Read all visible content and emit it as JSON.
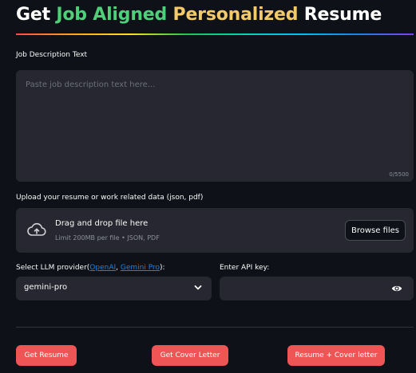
{
  "header": {
    "title_part1": "Get ",
    "title_part2": "Job Aligned",
    "title_part3": "Personalized",
    "title_part4": "Resume"
  },
  "job_description": {
    "label": "Job Description Text",
    "placeholder": "Paste job description text here...",
    "char_count": "0/5500"
  },
  "upload": {
    "label": "Upload your resume or work related data (json, pdf)",
    "drag_text": "Drag and drop file here",
    "limit_text": "Limit 200MB per file • JSON, PDF",
    "browse_label": "Browse files",
    "icon": "cloud-upload-icon"
  },
  "llm": {
    "label_prefix": "Select LLM provider(",
    "link_openai": "OpenAI",
    "separator": ", ",
    "link_gemini": "Gemini Pro",
    "label_suffix": "):",
    "selected": "gemini-pro"
  },
  "api_key": {
    "label": "Enter API key:",
    "value": ""
  },
  "buttons": {
    "resume": "Get Resume",
    "cover_letter": "Get Cover Letter",
    "both": "Resume + Cover letter"
  },
  "colors": {
    "background": "#0e1117",
    "input_bg": "#262730",
    "primary_button": "#ef5555",
    "title_green": "#4fcf7a",
    "title_yellow": "#f2c96b",
    "link": "#1c83e1"
  }
}
